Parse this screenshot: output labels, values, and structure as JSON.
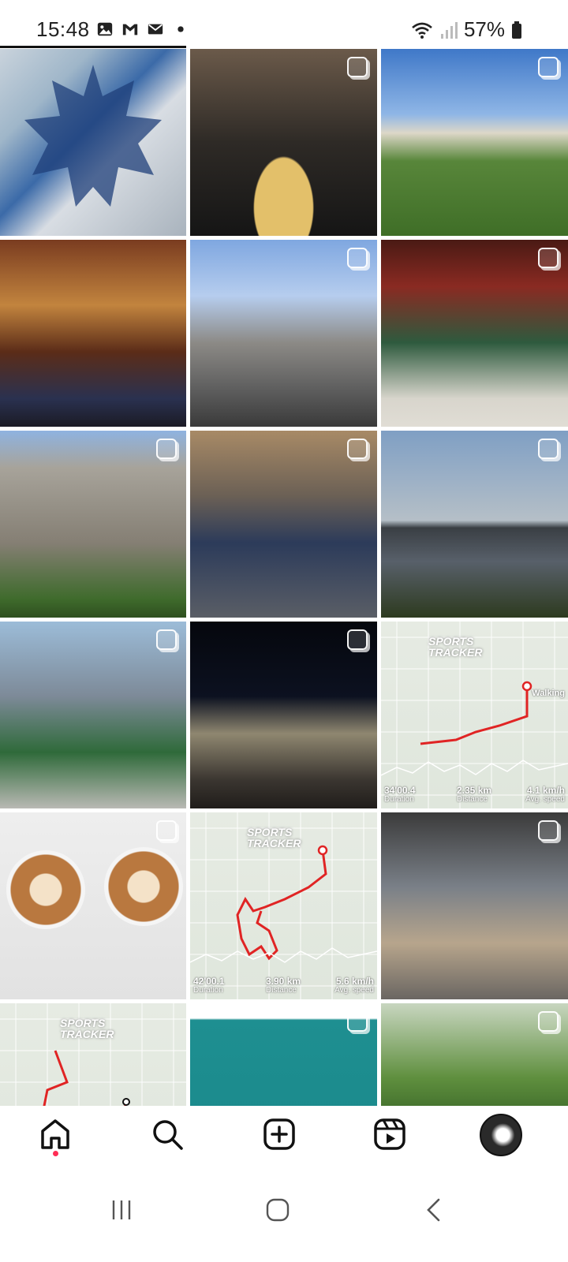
{
  "status_bar": {
    "time": "15:48",
    "left_icons": [
      "gallery-icon",
      "gmail-icon",
      "mail-icon",
      "dot-icon"
    ],
    "battery": "57%",
    "right_icons": [
      "wifi-icon",
      "signal-icon",
      "battery-icon"
    ]
  },
  "grid": {
    "tiles": [
      {
        "kind": "collage",
        "multi": false
      },
      {
        "kind": "fondue",
        "multi": true
      },
      {
        "kind": "castle",
        "multi": true
      },
      {
        "kind": "street-night",
        "multi": false
      },
      {
        "kind": "street-day",
        "multi": true
      },
      {
        "kind": "shop",
        "multi": true
      },
      {
        "kind": "building",
        "multi": true
      },
      {
        "kind": "station",
        "multi": true
      },
      {
        "kind": "river",
        "multi": true
      },
      {
        "kind": "downtown",
        "multi": true
      },
      {
        "kind": "church",
        "multi": true
      },
      {
        "kind": "map",
        "multi": false
      },
      {
        "kind": "coffee",
        "multi": true
      },
      {
        "kind": "map",
        "multi": false
      },
      {
        "kind": "market",
        "multi": true
      },
      {
        "kind": "map",
        "multi": false
      },
      {
        "kind": "couple-teal",
        "multi": true
      },
      {
        "kind": "greenhouse",
        "multi": true
      }
    ],
    "maps": {
      "brand_line1": "SPORTS",
      "brand_line2": "TRACKER",
      "map1": {
        "duration_value": "34'00.4",
        "duration_label": "Duration",
        "distance_value": "2.35 km",
        "distance_label": "Distance",
        "speed_value": "4.1 km/h",
        "speed_label": "Avg. speed",
        "activity": "Walking"
      },
      "map2": {
        "duration_value": "42'00.1",
        "duration_label": "Duration",
        "distance_value": "3.90 km",
        "distance_label": "Distance",
        "speed_value": "5.6 km/h",
        "speed_label": "Avg. speed"
      }
    }
  },
  "bottom_nav": {
    "items": [
      "home-icon",
      "search-icon",
      "create-icon",
      "reels-icon",
      "profile-avatar"
    ],
    "active": "home",
    "has_notification_dot": true
  },
  "system_nav": {
    "buttons": [
      "recents-icon",
      "home-circle-icon",
      "back-icon"
    ]
  },
  "colors": {
    "notification_dot": "#ff2d55",
    "route_red": "#e02424"
  }
}
